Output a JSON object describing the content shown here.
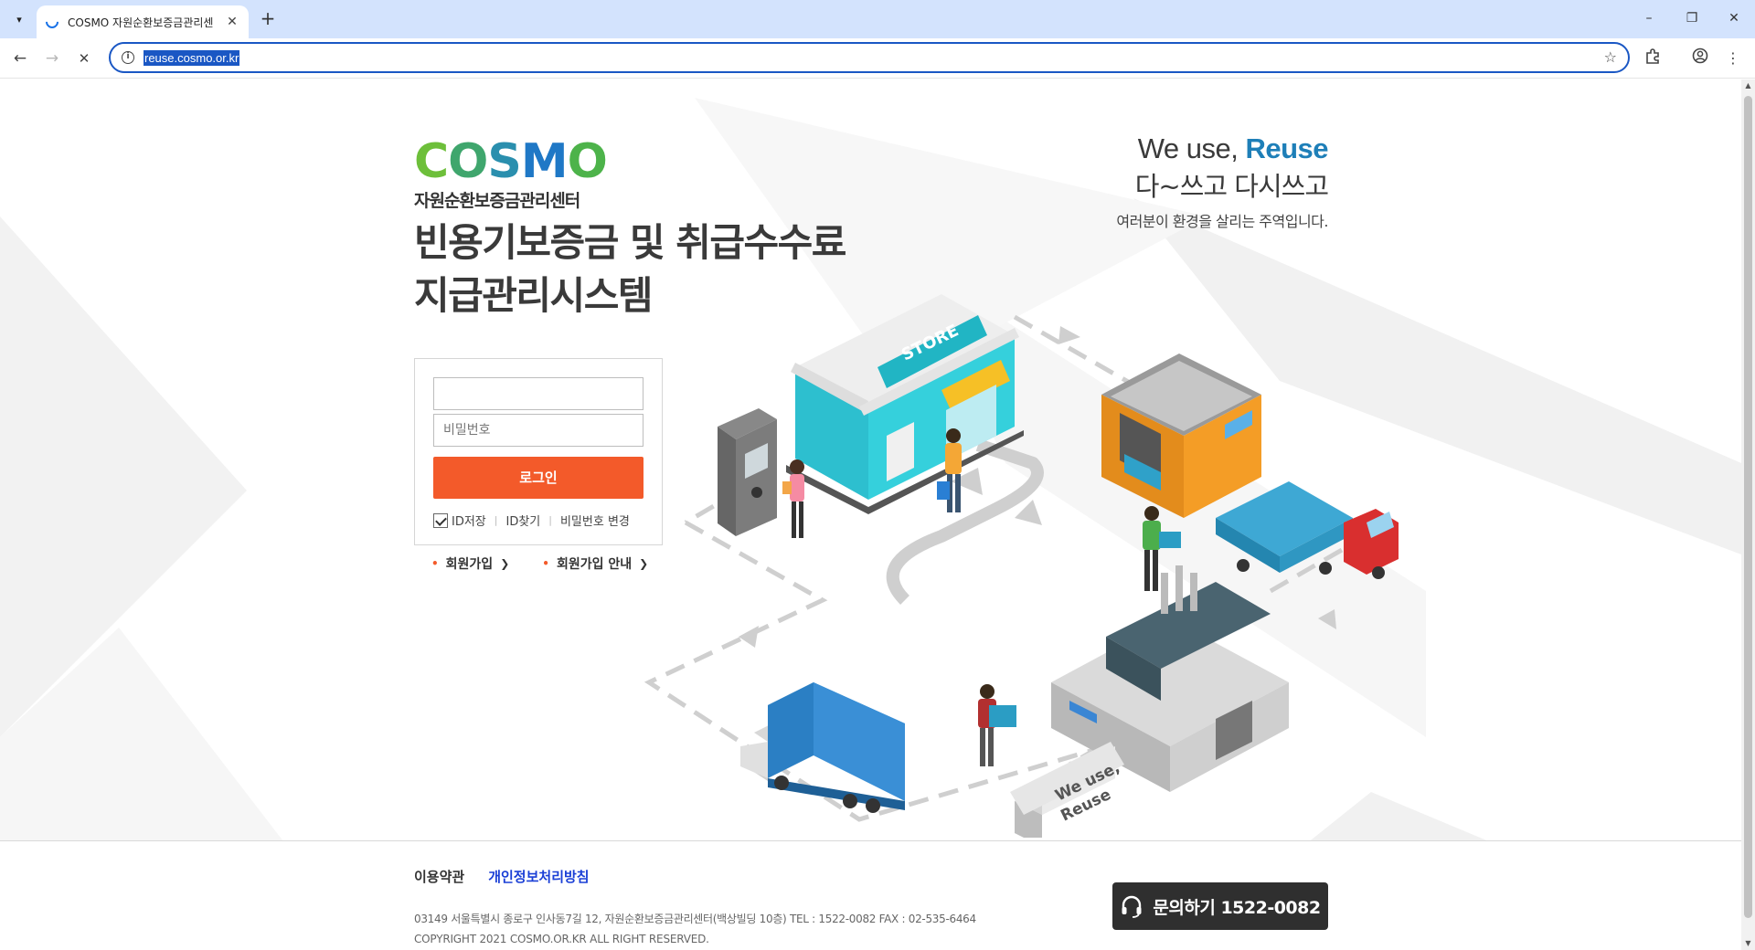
{
  "browser": {
    "tab_title": "COSMO 자원순환보증금관리센",
    "new_tab": "+",
    "url": "reuse.cosmo.or.kr",
    "window_controls": {
      "minimize": "–",
      "restore": "❐",
      "close": "✕"
    }
  },
  "logo": {
    "word": [
      "C",
      "O",
      "S",
      "M",
      "O"
    ],
    "subtitle": "자원순환보증금관리센터"
  },
  "title": {
    "line1": "빈용기보증금 및 취급수수료",
    "line2": "지급관리시스템"
  },
  "slogan": {
    "en_prefix": "We use, ",
    "en_accent": "Reuse",
    "ko": "다~쓰고 다시쓰고",
    "desc": "여러분이 환경을 살리는 주역입니다."
  },
  "login": {
    "id_value": "",
    "id_placeholder": "",
    "password_placeholder": "비밀번호",
    "button": "로그인",
    "save_id": "ID저장",
    "find_id": "ID찾기",
    "change_password": "비밀번호 변경",
    "save_id_checked": true
  },
  "join": {
    "signup": "회원가입",
    "signup_guide": "회원가입 안내"
  },
  "illustration": {
    "store_sign": "STORE",
    "sign_line1": "We use,",
    "sign_line2": "Reuse"
  },
  "footer": {
    "terms": "이용약관",
    "privacy": "개인정보처리방침",
    "address": "03149 서울특별시 종로구 인사동7길 12, 자원순환보증금관리센터(백상빌딩 10층) TEL : 1522-0082 FAX : 02-535-6464",
    "copyright": "COPYRIGHT 2021 COSMO.OR.KR ALL RIGHT RESERVED.",
    "contact": "문의하기 1522-0082"
  },
  "colors": {
    "accent_orange": "#f35a2a",
    "slogan_blue": "#1e7fb8",
    "privacy_link": "#1a3fd6",
    "contact_bg": "#2f2f2f"
  }
}
